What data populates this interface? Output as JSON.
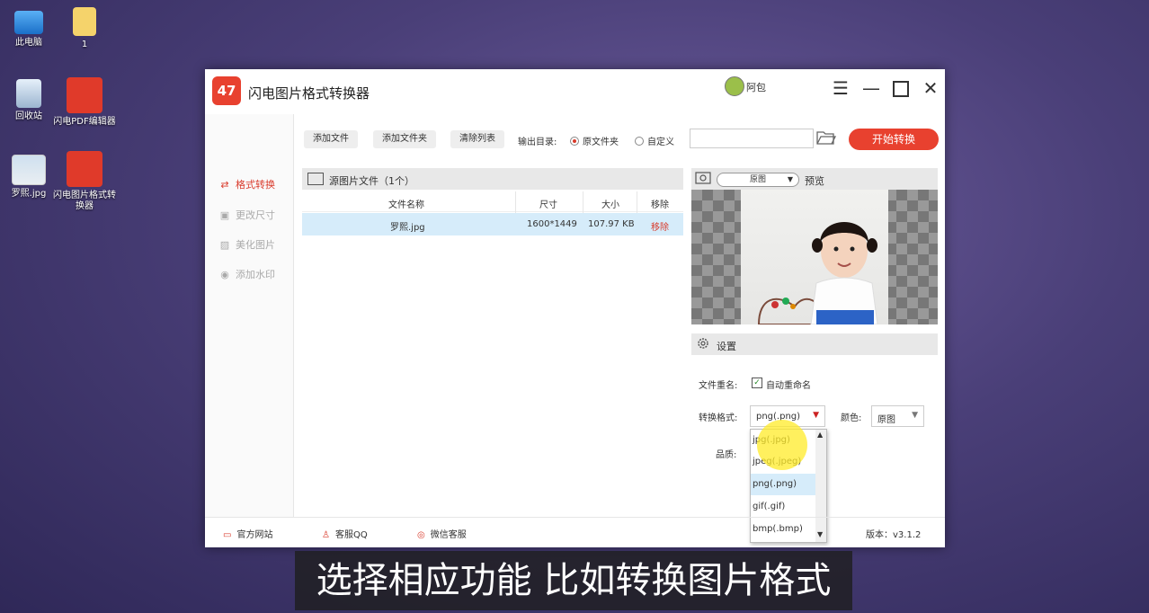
{
  "desktop": {
    "icons": [
      {
        "label": "此电脑"
      },
      {
        "label": "1"
      },
      {
        "label": "回收站"
      },
      {
        "label": "闪电PDF编辑器"
      },
      {
        "label": "罗熙.jpg"
      },
      {
        "label": "闪电图片格式转换器"
      }
    ]
  },
  "app": {
    "title": "闪电图片格式转换器",
    "logo_text": "47",
    "user_name": "阿包",
    "accent_color": "#e8412f"
  },
  "sidebar": {
    "items": [
      {
        "label": "格式转换",
        "icon": "swap-icon"
      },
      {
        "label": "更改尺寸",
        "icon": "resize-icon"
      },
      {
        "label": "美化图片",
        "icon": "image-edit-icon"
      },
      {
        "label": "添加水印",
        "icon": "stamp-icon"
      }
    ]
  },
  "toolbar": {
    "add_file": "添加文件",
    "add_folder": "添加文件夹",
    "clear_list": "清除列表",
    "output_dir_label": "输出目录:",
    "radio_original": "原文件夹",
    "radio_custom": "自定义",
    "path_value": "",
    "start": "开始转换"
  },
  "files": {
    "header": "源图片文件（1个）",
    "columns": [
      "文件名称",
      "尺寸",
      "大小",
      "移除"
    ],
    "rows": [
      {
        "name": "罗熙.jpg",
        "dims": "1600*1449",
        "size": "107.97 KB",
        "remove": "移除"
      }
    ]
  },
  "preview": {
    "mode": "原图",
    "label": "预览"
  },
  "settings": {
    "header": "设置",
    "rename_label": "文件重名:",
    "auto_rename": "自动重命名",
    "format_label": "转换格式:",
    "format_value": "png(.png)",
    "color_label": "颜色:",
    "color_value": "原图",
    "quality_label": "品质:",
    "format_options": [
      "jpg(.jpg)",
      "jpeg(.jpeg)",
      "png(.png)",
      "gif(.gif)",
      "bmp(.bmp)"
    ]
  },
  "footer": {
    "website": "官方网站",
    "qq": "客服QQ",
    "wechat": "微信客服",
    "version": "版本：v3.1.2"
  },
  "caption": "选择相应功能 比如转换图片格式"
}
